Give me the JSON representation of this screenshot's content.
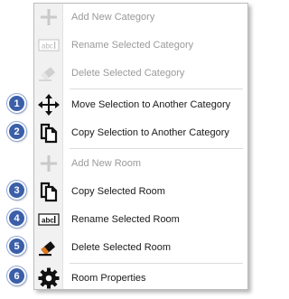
{
  "menu": {
    "items": [
      {
        "label": "Add New Category",
        "icon": "plus-icon",
        "enabled": false
      },
      {
        "label": "Rename Selected Category",
        "icon": "rename-icon",
        "enabled": false
      },
      {
        "label": "Delete Selected Category",
        "icon": "eraser-icon",
        "enabled": false
      },
      {
        "label": "Move Selection to Another Category",
        "icon": "move-arrows-icon",
        "enabled": true
      },
      {
        "label": "Copy Selection to Another Category",
        "icon": "copy-icon",
        "enabled": true
      },
      {
        "label": "Add New Room",
        "icon": "plus-icon",
        "enabled": false
      },
      {
        "label": "Copy Selected Room",
        "icon": "copy-icon",
        "enabled": true
      },
      {
        "label": "Rename Selected Room",
        "icon": "rename-icon",
        "enabled": true
      },
      {
        "label": "Delete Selected Room",
        "icon": "eraser-icon",
        "enabled": true
      },
      {
        "label": "Room Properties",
        "icon": "gear-icon",
        "enabled": true
      }
    ]
  },
  "callouts": [
    "1",
    "2",
    "3",
    "4",
    "5",
    "6"
  ],
  "colors": {
    "callout": "#3b5fa9",
    "disabled_text": "#9a9a9a",
    "eraser_tip": "#e07a1f"
  }
}
